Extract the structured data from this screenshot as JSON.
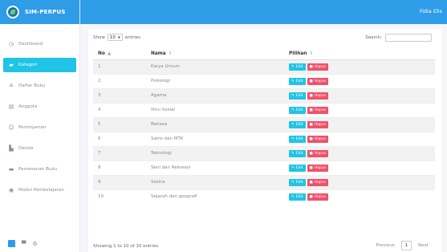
{
  "app": {
    "brand": "SIM-PERPUS",
    "user": "Fidia Elis"
  },
  "sidebar": {
    "items": [
      {
        "label": "Dashboard",
        "icon": "dashboard-icon"
      },
      {
        "label": "Kategori",
        "icon": "category-icon",
        "active": true
      },
      {
        "label": "Daftar Buku",
        "icon": "book-list-icon"
      },
      {
        "label": "Anggota",
        "icon": "members-icon"
      },
      {
        "label": "Peminjaman",
        "icon": "loan-icon"
      },
      {
        "label": "Denda",
        "icon": "fine-icon"
      },
      {
        "label": "Pemesanan Buku",
        "icon": "order-icon"
      },
      {
        "label": "Modul Pembelajaran",
        "icon": "module-icon"
      }
    ]
  },
  "table_controls": {
    "show_label": "Show",
    "entries_value": "10",
    "entries_label": "entries",
    "search_label": "Search:"
  },
  "table": {
    "headers": {
      "no": "No",
      "nama": "Nama",
      "pilihan": "Pilihan"
    },
    "rows": [
      {
        "no": "1",
        "nama": "Karya Umum"
      },
      {
        "no": "2",
        "nama": "Psikologi"
      },
      {
        "no": "3",
        "nama": "Agama"
      },
      {
        "no": "4",
        "nama": "Ilmu Sosial"
      },
      {
        "no": "5",
        "nama": "Bahasa"
      },
      {
        "no": "6",
        "nama": "Sains dan MTK"
      },
      {
        "no": "7",
        "nama": "Teknologi"
      },
      {
        "no": "8",
        "nama": "Seni dan Rekreasi"
      },
      {
        "no": "9",
        "nama": "Sastra"
      },
      {
        "no": "10",
        "nama": "Sejarah dan geografi"
      }
    ],
    "edit_label": "Edit",
    "hapus_label": "Hapus"
  },
  "footer": {
    "info": "Showing 1 to 10 of 10 entries",
    "previous": "Previous",
    "page": "1",
    "next": "Next"
  },
  "colors": {
    "primary": "#2f9ce8",
    "active": "#20c4e6",
    "danger": "#f0516a"
  }
}
